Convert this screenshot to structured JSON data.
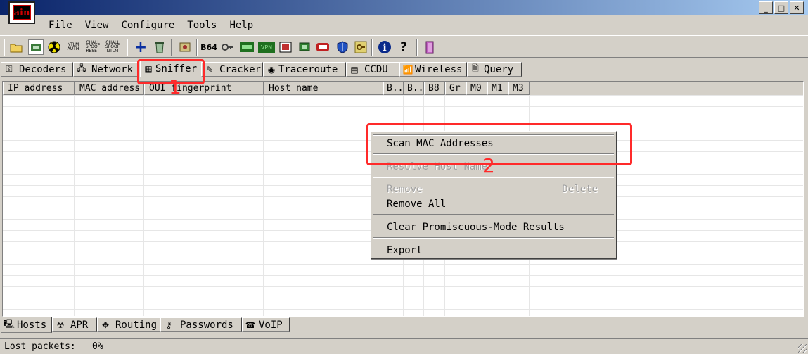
{
  "app": {
    "logo_text": "ain"
  },
  "window_buttons": [
    "_",
    "□",
    "✕"
  ],
  "menu": [
    "File",
    "View",
    "Configure",
    "Tools",
    "Help"
  ],
  "toolbar": {
    "ntlm_auth": "NTLM AUTH",
    "chall_spoof_reset": "CHALL SPOOF RESET",
    "chall_spoof_ntlm": "CHALL SPOOF NTLM",
    "b64": "B64",
    "vpn": "VPN"
  },
  "top_tabs": [
    "Decoders",
    "Network",
    "Sniffer",
    "Cracker",
    "Traceroute",
    "CCDU",
    "Wireless",
    "Query"
  ],
  "columns": [
    "IP address",
    "MAC address",
    "OUI fingerprint",
    "Host name",
    "B..",
    "B..",
    "B8",
    "Gr",
    "M0",
    "M1",
    "M3"
  ],
  "bottom_tabs": [
    "Hosts",
    "APR",
    "Routing",
    "Passwords",
    "VoIP"
  ],
  "status": {
    "label": "Lost packets:",
    "value": "0%"
  },
  "context_menu": {
    "scan": "Scan MAC Addresses",
    "resolve": "Resolve Host Name",
    "remove": "Remove",
    "remove_shortcut": "Delete",
    "remove_all": "Remove All",
    "clear": "Clear Promiscuous-Mode Results",
    "export": "Export"
  },
  "annotations": {
    "one": "1",
    "two": "2",
    "color": "#ff2a2a"
  }
}
